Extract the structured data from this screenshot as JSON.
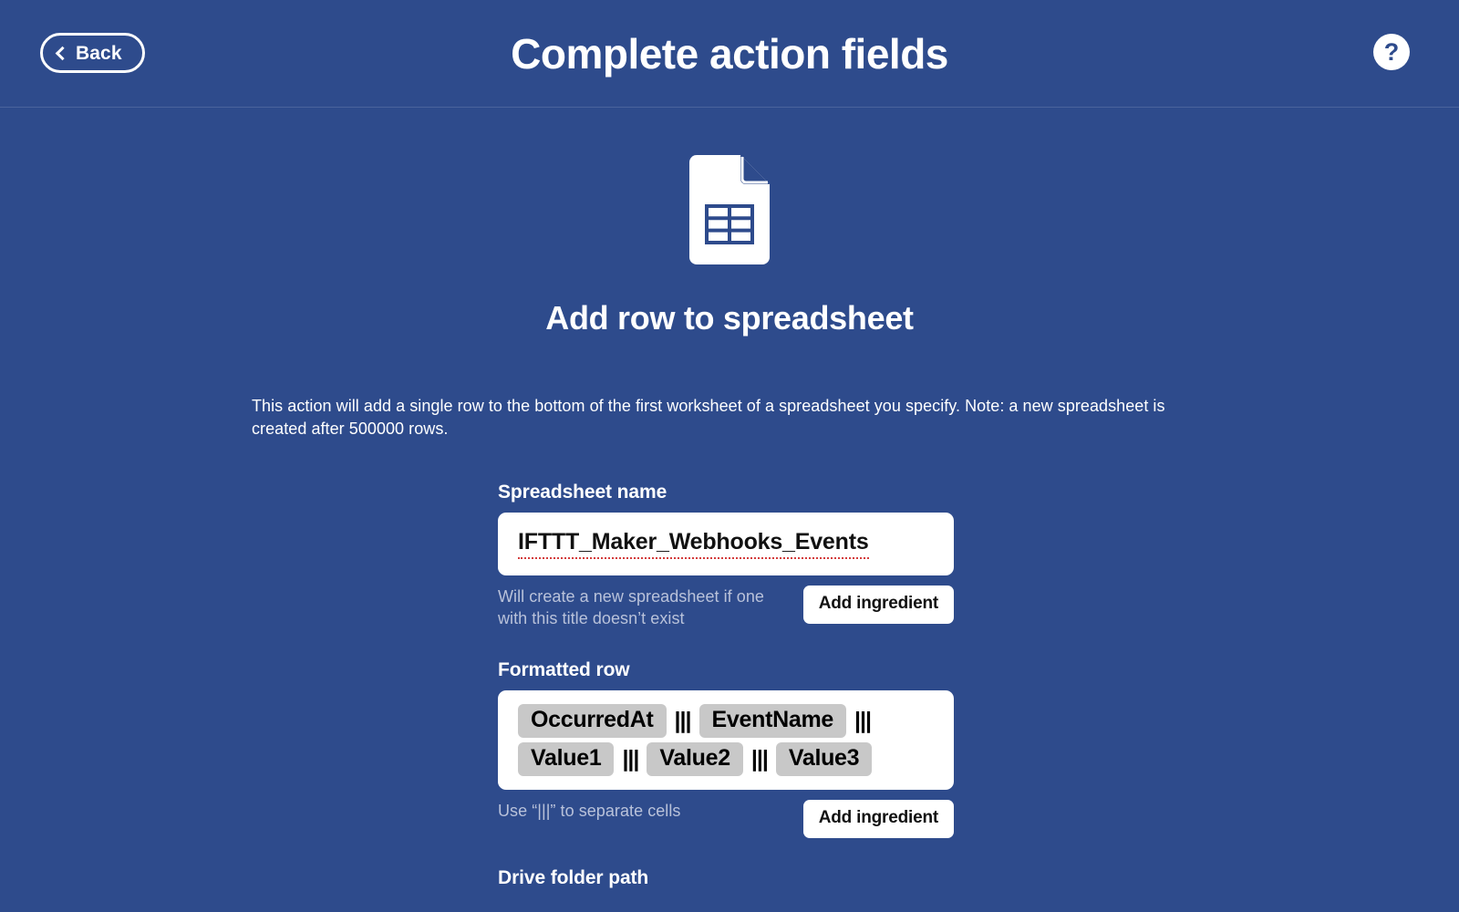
{
  "theme": {
    "background": "#2e4b8c",
    "surface": "#ffffff",
    "text_on_dark": "#ffffff",
    "hint_text": "#b9c2da",
    "token_background": "#c8c8c8",
    "token_text": "#000000",
    "spellcheck_underline": "#d33b3b",
    "divider": "#4a649d"
  },
  "header": {
    "back_label": "Back",
    "back_icon": "chevron-left-icon",
    "title": "Complete action fields",
    "help_icon": "question-mark-icon",
    "help_glyph": "?"
  },
  "action": {
    "icon_name": "spreadsheet-document-icon",
    "title": "Add row to spreadsheet",
    "description": "This action will add a single row to the bottom of the first worksheet of a spreadsheet you specify. Note: a new spreadsheet is created after 500000 rows."
  },
  "fields": [
    {
      "label": "Spreadsheet name",
      "type": "text",
      "value": "IFTTT_Maker_Webhooks_Events",
      "spellcheck_flagged": true,
      "hint": "Will create a new spreadsheet if one with this title doesn’t exist",
      "button_label": "Add ingredient"
    },
    {
      "label": "Formatted row",
      "type": "tokens",
      "tokens": [
        {
          "kind": "ingredient",
          "text": "OccurredAt"
        },
        {
          "kind": "separator",
          "text": "|||"
        },
        {
          "kind": "ingredient",
          "text": "EventName"
        },
        {
          "kind": "separator",
          "text": "|||"
        },
        {
          "kind": "ingredient",
          "text": "Value1"
        },
        {
          "kind": "separator",
          "text": "|||"
        },
        {
          "kind": "ingredient",
          "text": "Value2"
        },
        {
          "kind": "separator",
          "text": "|||"
        },
        {
          "kind": "ingredient",
          "text": "Value3"
        }
      ],
      "hint": "Use “|||” to separate cells",
      "button_label": "Add ingredient"
    },
    {
      "label": "Drive folder path",
      "type": "text",
      "value": "",
      "hint": "",
      "button_label": ""
    }
  ]
}
